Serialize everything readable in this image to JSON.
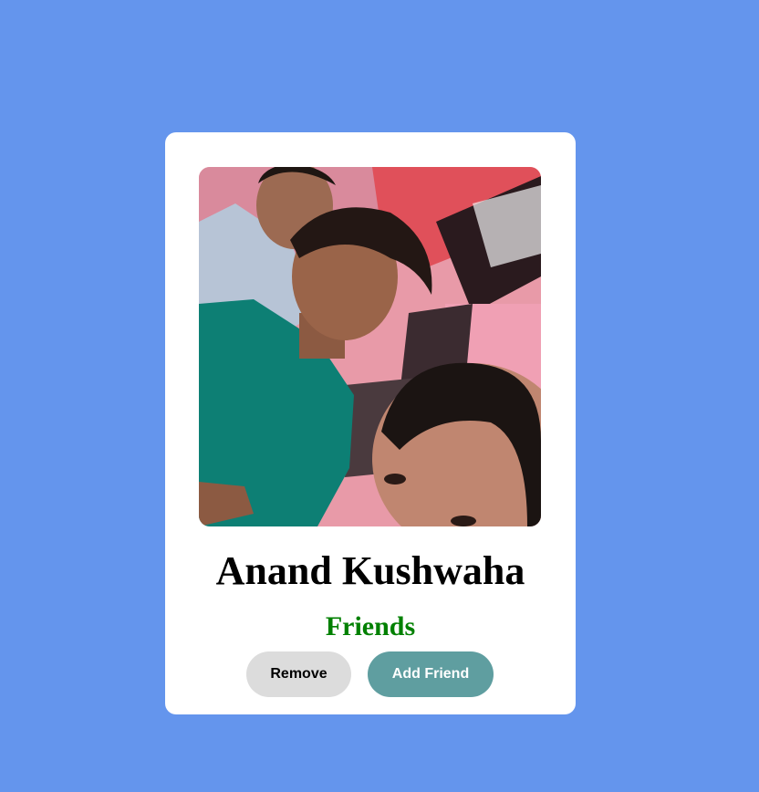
{
  "profile": {
    "name": "Anand Kushwaha",
    "status": "Friends",
    "photo_icon": "profile-photo"
  },
  "actions": {
    "remove_label": "Remove",
    "add_label": "Add Friend"
  },
  "colors": {
    "background": "#6495ed",
    "card": "#ffffff",
    "status_text": "#008000",
    "remove_button": "#dcdcdc",
    "add_button": "#5f9ea0"
  }
}
